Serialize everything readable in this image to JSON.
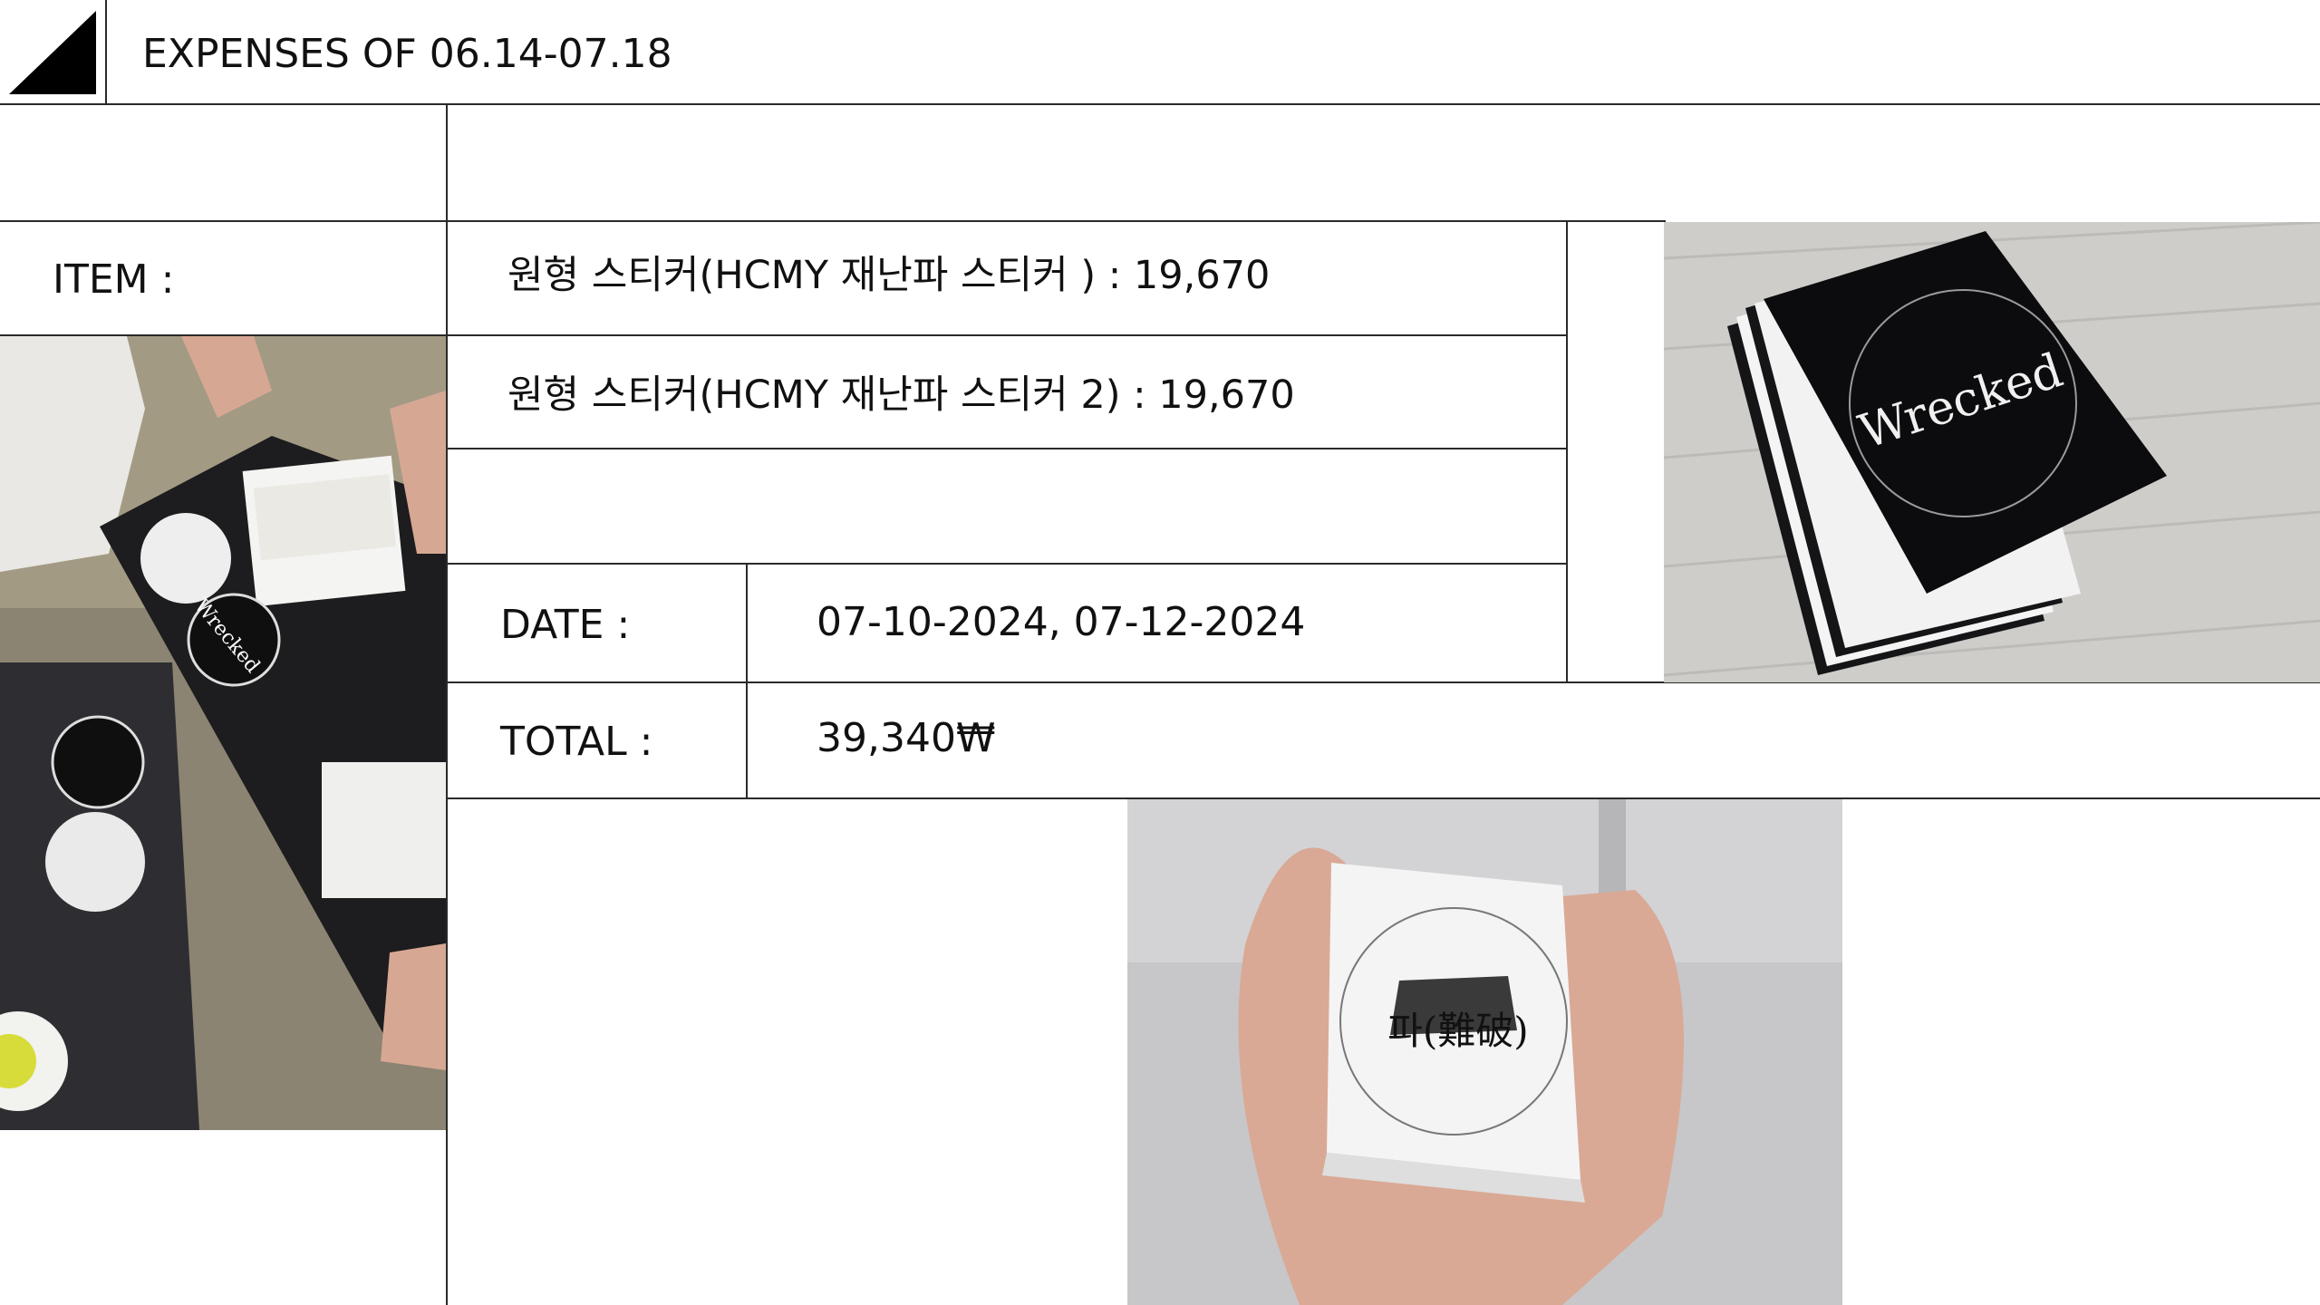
{
  "header": {
    "title": "EXPENSES OF 06.14-07.18"
  },
  "item_label": "ITEM :",
  "items": [
    "원형 스티커(HCMY 재난파 스티커 ) : 19,670",
    "원형 스티커(HCMY 재난파 스티커 2) : 19,670"
  ],
  "date_label": "DATE :",
  "date_value": "07-10-2024, 07-12-2024",
  "total_label": "TOTAL :",
  "total_value": "39,340₩",
  "photos": {
    "left_sticker_word": "Wrecked",
    "right_sticker_word": "Wrecked",
    "bottom_sticker_word": "파(難破)"
  }
}
